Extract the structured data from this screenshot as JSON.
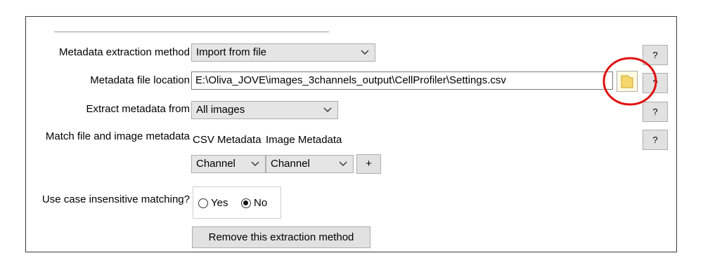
{
  "form": {
    "extraction_method": {
      "label": "Metadata extraction method",
      "selected": "Import from file",
      "help": "?"
    },
    "file_location": {
      "label": "Metadata file location",
      "value": "E:\\Oliva_JOVE\\images_3channels_output\\CellProfiler\\Settings.csv",
      "help": "?"
    },
    "extract_from": {
      "label": "Extract metadata from",
      "selected": "All images",
      "help": "?"
    },
    "match": {
      "label": "Match file and image metadata",
      "csv_header": "CSV Metadata",
      "image_header": "Image Metadata",
      "csv_selected": "Channel",
      "image_selected": "Channel",
      "add_label": "+",
      "help": "?"
    },
    "case_insensitive": {
      "label": "Use case insensitive matching?",
      "options": [
        "Yes",
        "No"
      ],
      "selected": "No"
    },
    "remove_button": "Remove this extraction method"
  },
  "icons": {
    "dropdown": "chevron-down-icon",
    "browse": "folder-icon"
  },
  "colors": {
    "annotation_circle": "#e01010",
    "folder_fill": "#f6d86a"
  }
}
